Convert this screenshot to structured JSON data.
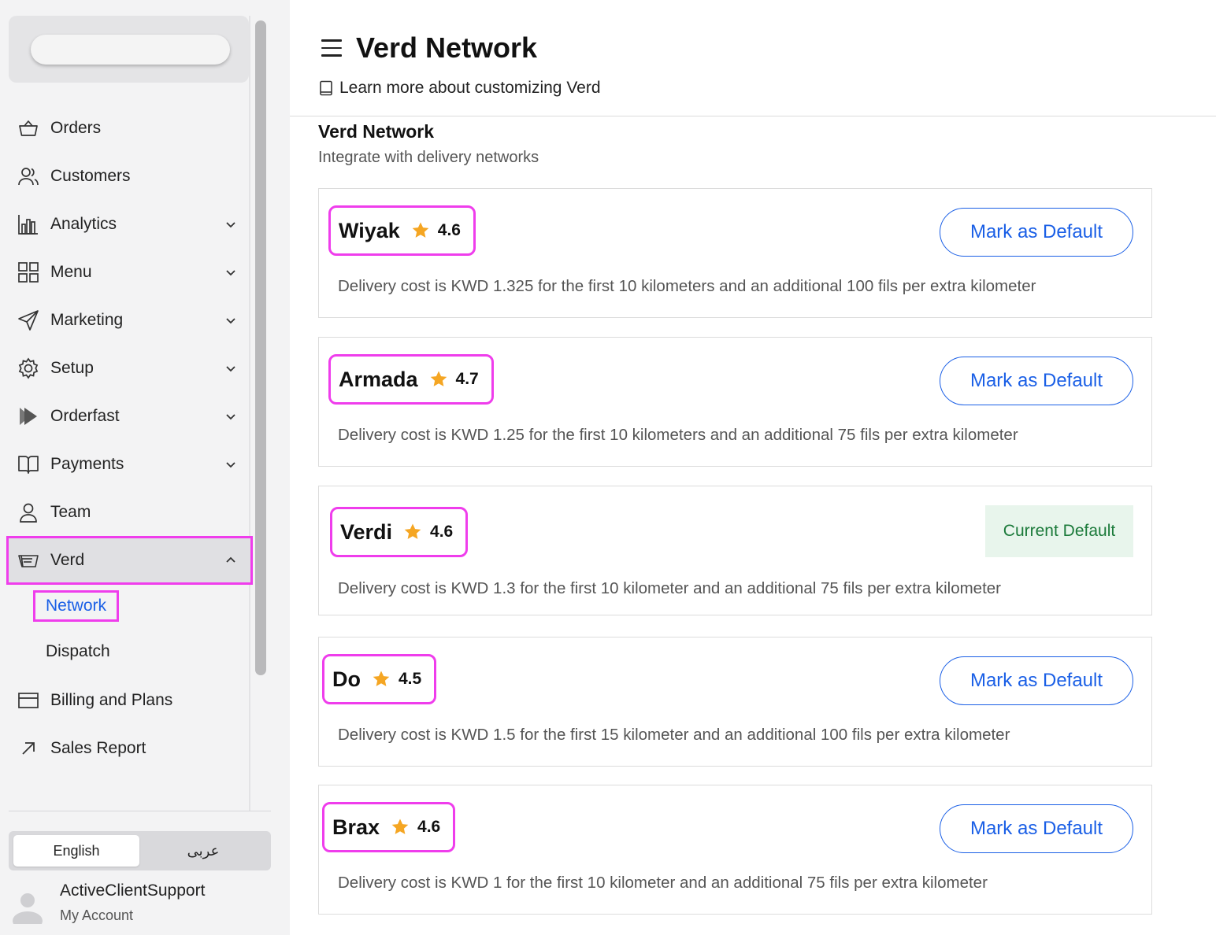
{
  "sidebar": {
    "nav": [
      {
        "label": "Orders",
        "icon": "shopping-basket-icon"
      },
      {
        "label": "Customers",
        "icon": "users-icon"
      },
      {
        "label": "Analytics",
        "icon": "bar-chart-icon"
      },
      {
        "label": "Menu",
        "icon": "grid-icon"
      },
      {
        "label": "Marketing",
        "icon": "send-icon"
      },
      {
        "label": "Setup",
        "icon": "gear-icon"
      },
      {
        "label": "Orderfast",
        "icon": "play-icon"
      },
      {
        "label": "Payments",
        "icon": "book-open-icon"
      },
      {
        "label": "Team",
        "icon": "user-icon"
      },
      {
        "label": "Verd",
        "icon": "delivery-icon"
      },
      {
        "label": "Billing and Plans",
        "icon": "credit-card-icon"
      },
      {
        "label": "Sales Report",
        "icon": "arrow-up-right-icon"
      }
    ],
    "sub": {
      "network": "Network",
      "dispatch": "Dispatch"
    },
    "languages": {
      "english": "English",
      "arabic": "عربى"
    },
    "account": {
      "name": "ActiveClientSupport",
      "sub": "My Account"
    }
  },
  "header": {
    "title": "Verd Network",
    "learn_more": "Learn more about customizing Verd"
  },
  "section": {
    "title": "Verd Network",
    "subtitle": "Integrate with delivery networks"
  },
  "providers": [
    {
      "name": "Wiyak",
      "rating": "4.6",
      "action": "Mark as Default",
      "description": "Delivery cost is KWD 1.325 for the first 10 kilometers and an additional 100 fils per extra kilometer"
    },
    {
      "name": "Armada",
      "rating": "4.7",
      "action": "Mark as Default",
      "description": "Delivery cost is KWD 1.25 for the first 10 kilometers and an additional 75 fils per extra kilometer"
    },
    {
      "name": "Verdi",
      "rating": "4.6",
      "status": "Current Default",
      "description": "Delivery cost is KWD 1.3 for the first 10 kilometer and an additional 75 fils per extra kilometer"
    },
    {
      "name": "Do",
      "rating": "4.5",
      "action": "Mark as Default",
      "description": "Delivery cost is KWD 1.5 for the first 15 kilometer and an additional 100 fils per extra kilometer"
    },
    {
      "name": "Brax",
      "rating": "4.6",
      "action": "Mark as Default",
      "description": "Delivery cost is KWD 1 for the first 10 kilometer and an additional 75 fils per extra kilometer"
    }
  ],
  "colors": {
    "accent": "#1a5fe6",
    "highlight": "#ef3dec",
    "star": "#f5a623",
    "success_bg": "#e8f5ec",
    "success_text": "#1b7a3a"
  }
}
